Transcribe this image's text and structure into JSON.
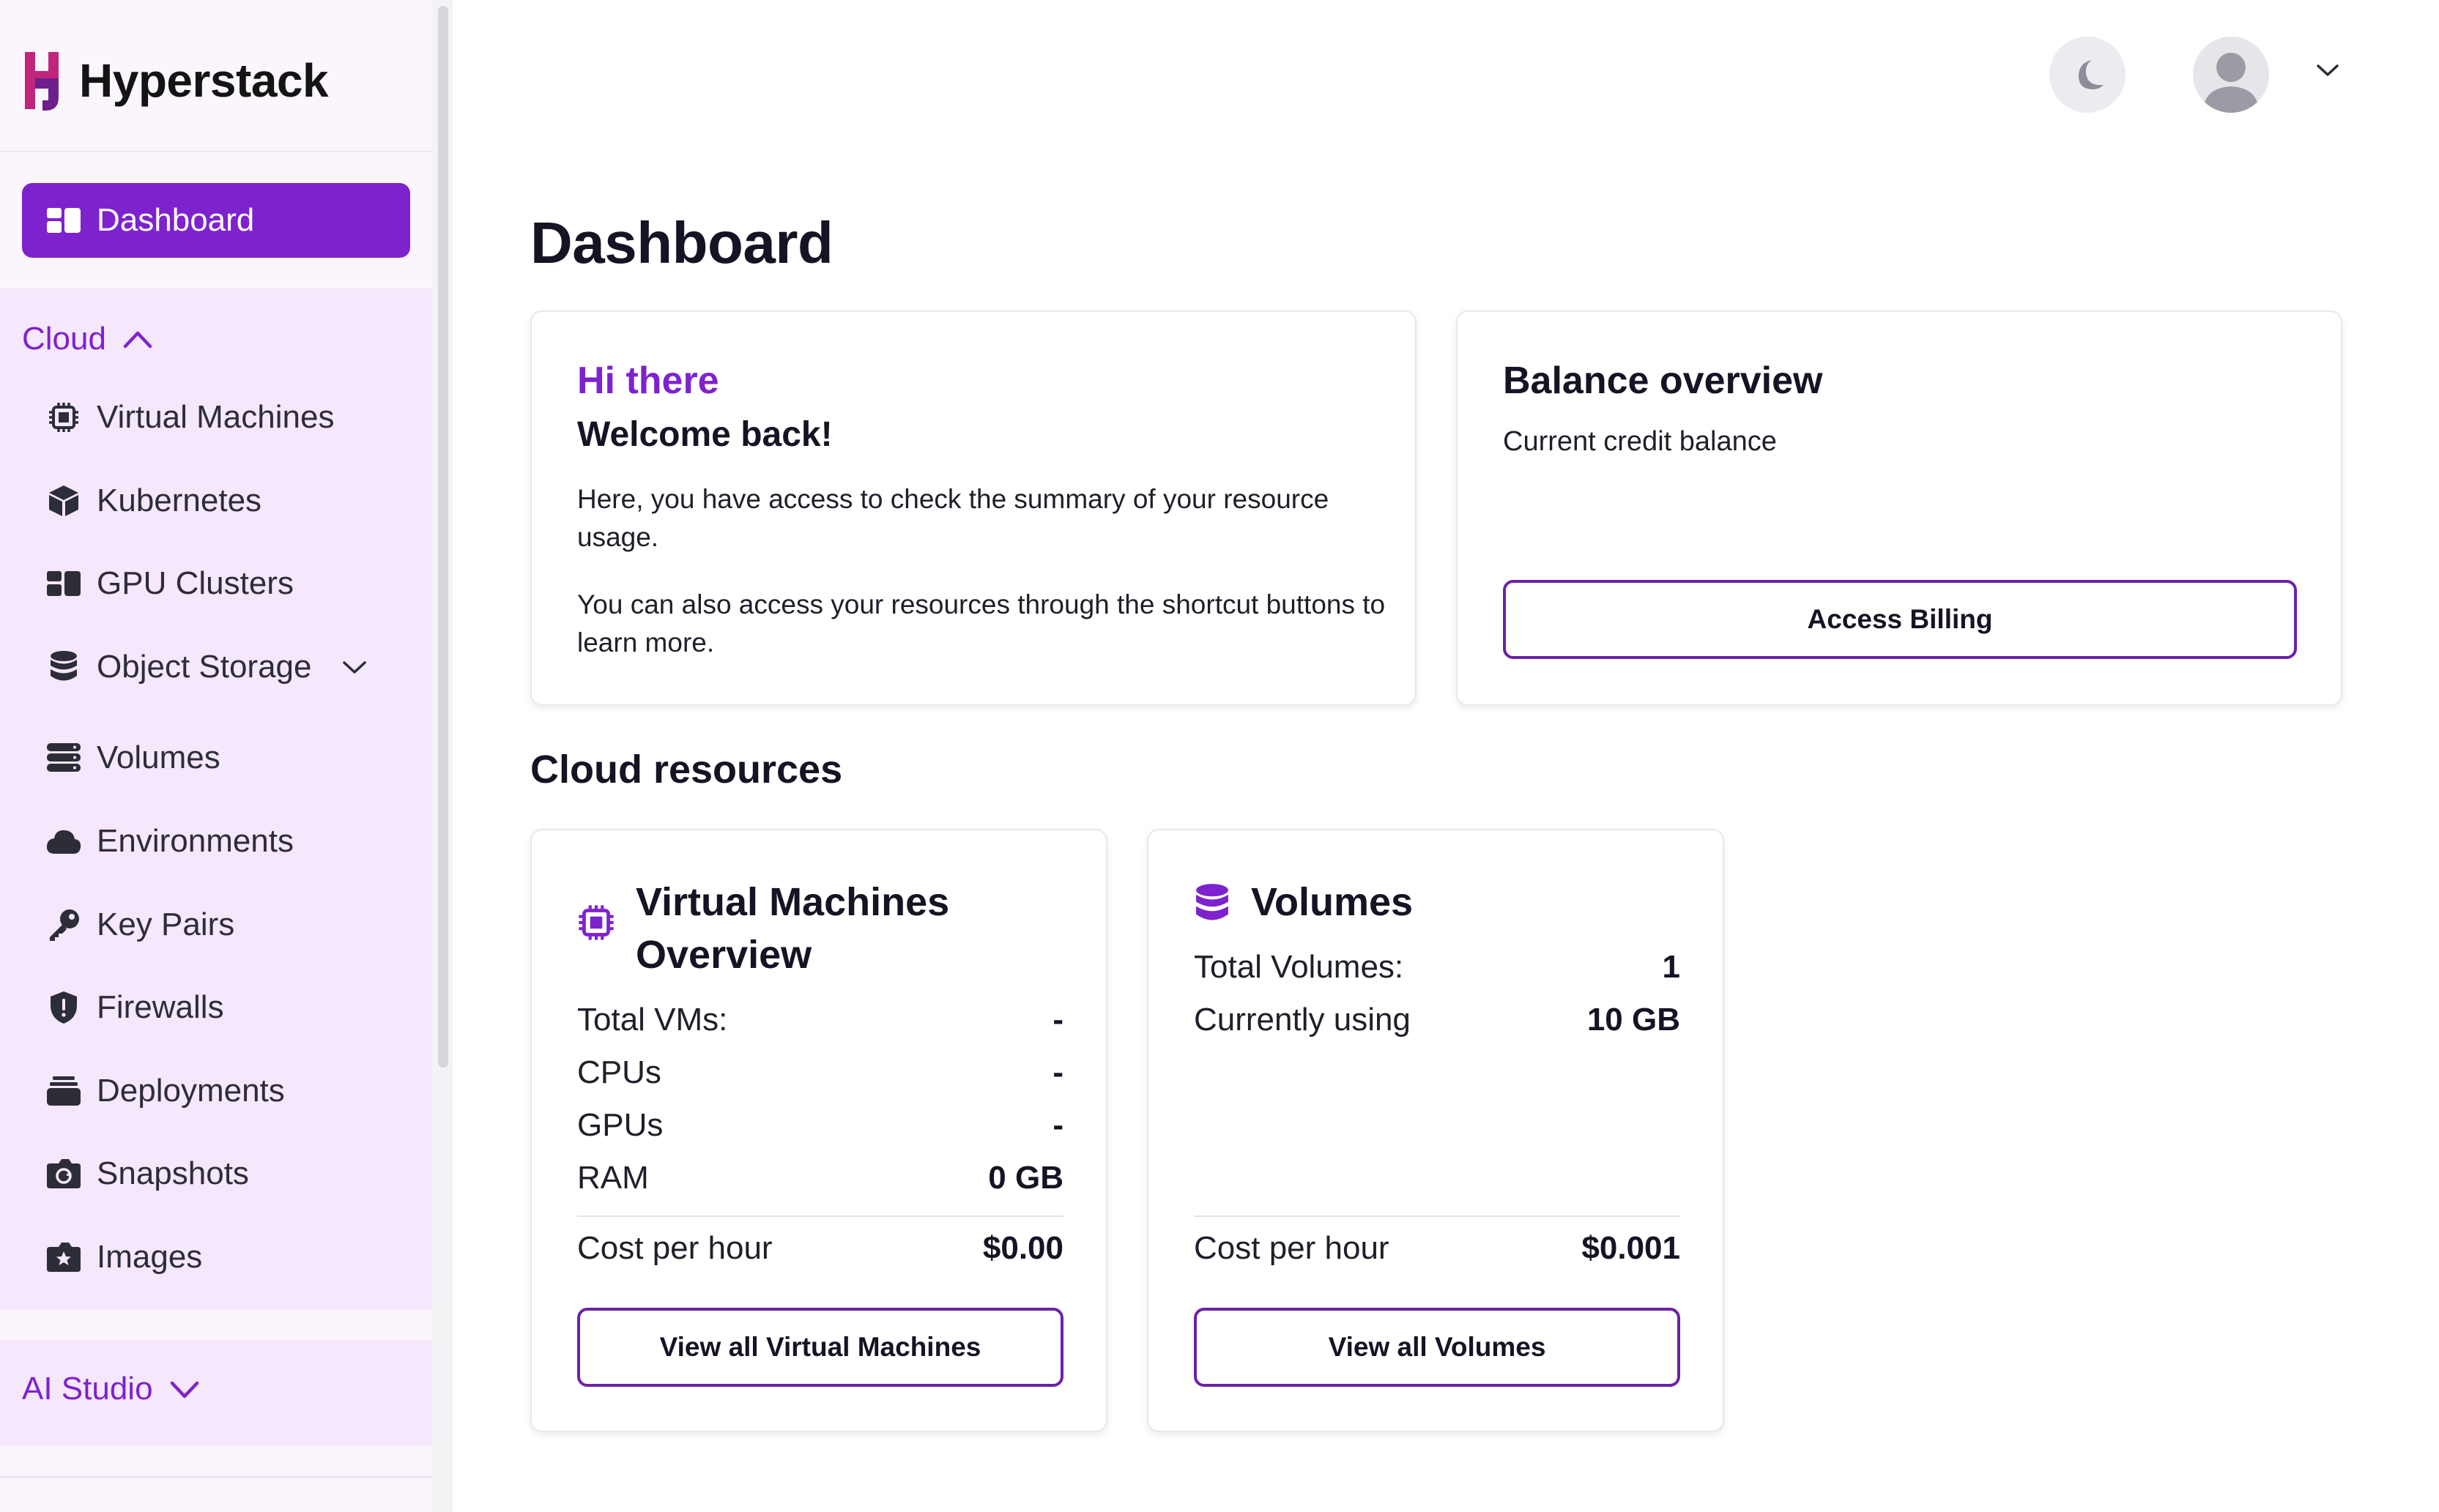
{
  "brand": {
    "name": "Hyperstack"
  },
  "colors": {
    "accent": "#7e22ce",
    "sidebar_bg": "#f5e7fc",
    "button_border": "#6b21a8"
  },
  "sidebar": {
    "dashboard": {
      "label": "Dashboard",
      "icon": "dashboard-icon"
    },
    "cloud": {
      "label": "Cloud",
      "expanded": true,
      "items": [
        {
          "label": "Virtual Machines",
          "icon": "cpu-icon"
        },
        {
          "label": "Kubernetes",
          "icon": "cube-icon"
        },
        {
          "label": "GPU Clusters",
          "icon": "clusters-icon"
        },
        {
          "label": "Object Storage",
          "icon": "database-icon",
          "has_submenu": true
        },
        {
          "label": "Volumes",
          "icon": "server-stack-icon"
        },
        {
          "label": "Environments",
          "icon": "cloud-icon"
        },
        {
          "label": "Key Pairs",
          "icon": "key-icon"
        },
        {
          "label": "Firewalls",
          "icon": "shield-icon"
        },
        {
          "label": "Deployments",
          "icon": "archive-box-icon"
        },
        {
          "label": "Snapshots",
          "icon": "camera-icon"
        },
        {
          "label": "Images",
          "icon": "image-star-icon"
        }
      ]
    },
    "ai_studio": {
      "label": "AI Studio",
      "expanded": false
    }
  },
  "header": {
    "theme_toggle_icon": "moon-icon",
    "avatar_icon": "user-avatar-icon"
  },
  "main": {
    "title": "Dashboard",
    "welcome": {
      "greeting": "Hi there",
      "heading": "Welcome back!",
      "para1": "Here, you have access to check the summary of your resource usage.",
      "para2": "You can also access your resources through the shortcut buttons to learn more."
    },
    "balance": {
      "title": "Balance overview",
      "subtitle": "Current credit balance",
      "button": "Access Billing"
    },
    "cloud_resources_title": "Cloud resources",
    "vm_card": {
      "title_line1": "Virtual Machines",
      "title_line2": "Overview",
      "rows": [
        {
          "label": "Total VMs:",
          "value": "-"
        },
        {
          "label": "CPUs",
          "value": "-"
        },
        {
          "label": "GPUs",
          "value": "-"
        },
        {
          "label": "RAM",
          "value": "0 GB"
        }
      ],
      "cost_label": "Cost per hour",
      "cost_value": "$0.00",
      "button": "View all Virtual Machines"
    },
    "volumes_card": {
      "title": "Volumes",
      "rows": [
        {
          "label": "Total Volumes:",
          "value": "1"
        },
        {
          "label": "Currently using",
          "value": "10 GB"
        }
      ],
      "cost_label": "Cost per hour",
      "cost_value": "$0.001",
      "button": "View all Volumes"
    }
  }
}
